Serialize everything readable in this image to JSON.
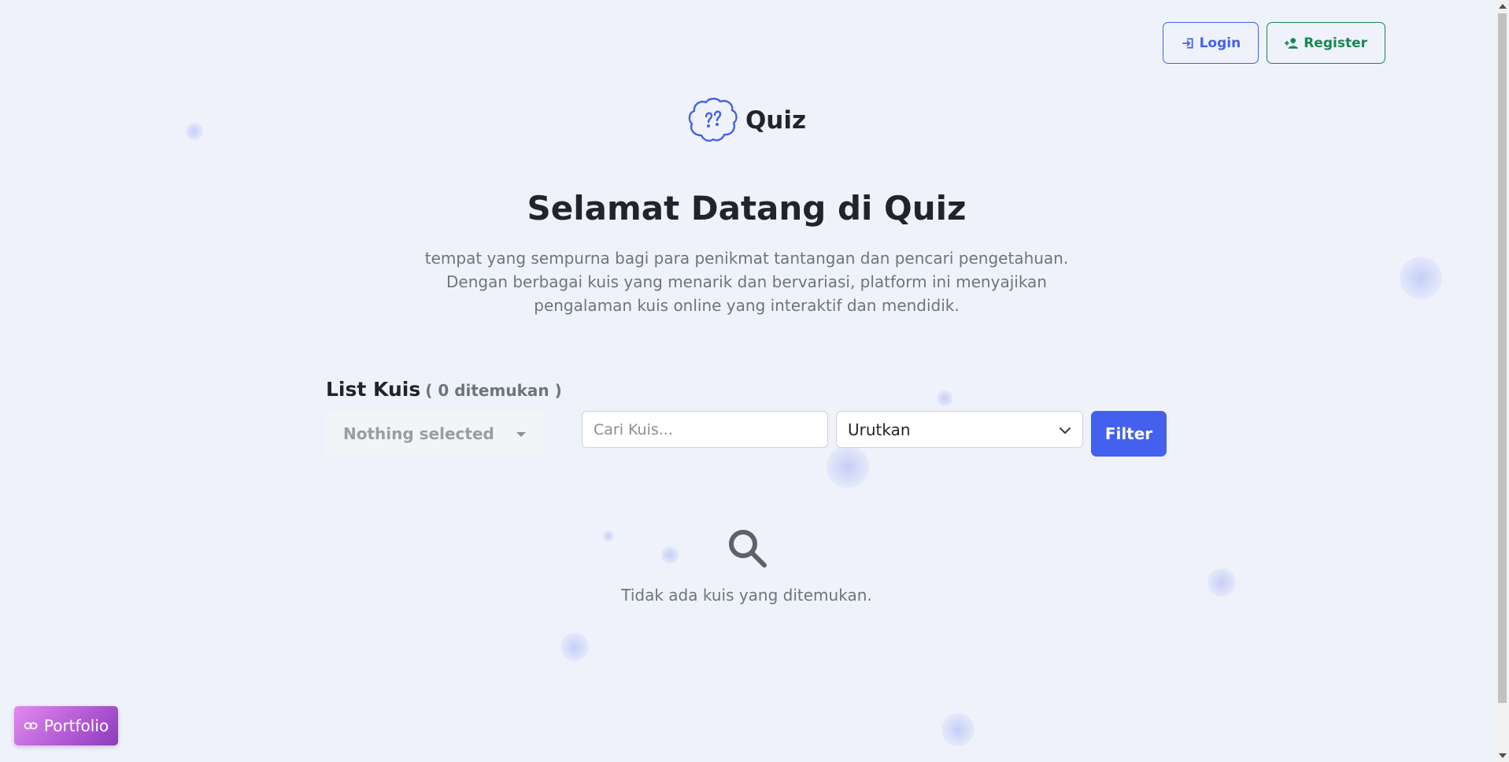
{
  "auth": {
    "login_label": "Login",
    "register_label": "Register"
  },
  "brand": {
    "name": "Quiz",
    "logo_icon": "brain-question-icon"
  },
  "hero": {
    "title": "Selamat Datang di Quiz",
    "description_lines": [
      "tempat yang sempurna bagi para penikmat tantangan dan pencari pengetahuan.",
      "Dengan berbagai kuis yang menarik dan bervariasi, platform ini menyajikan",
      "pengalaman kuis online yang interaktif dan mendidik."
    ]
  },
  "list": {
    "title": "List Kuis",
    "count_text": "( 0 ditemukan )"
  },
  "filters": {
    "category_selected": "Nothing selected",
    "search_placeholder": "Cari Kuis...",
    "sort_selected": "Urutkan",
    "filter_label": "Filter"
  },
  "empty_state": {
    "icon": "search-icon",
    "message": "Tidak ada kuis yang ditemukan."
  },
  "portfolio": {
    "label": "Portfolio",
    "icon": "link-icon"
  },
  "colors": {
    "background": "#eff2fb",
    "primary": "#4361ee",
    "success": "#198754",
    "muted": "#6c757d",
    "portfolio_gradient_start": "#e08af0",
    "portfolio_gradient_end": "#8c3cbd"
  }
}
